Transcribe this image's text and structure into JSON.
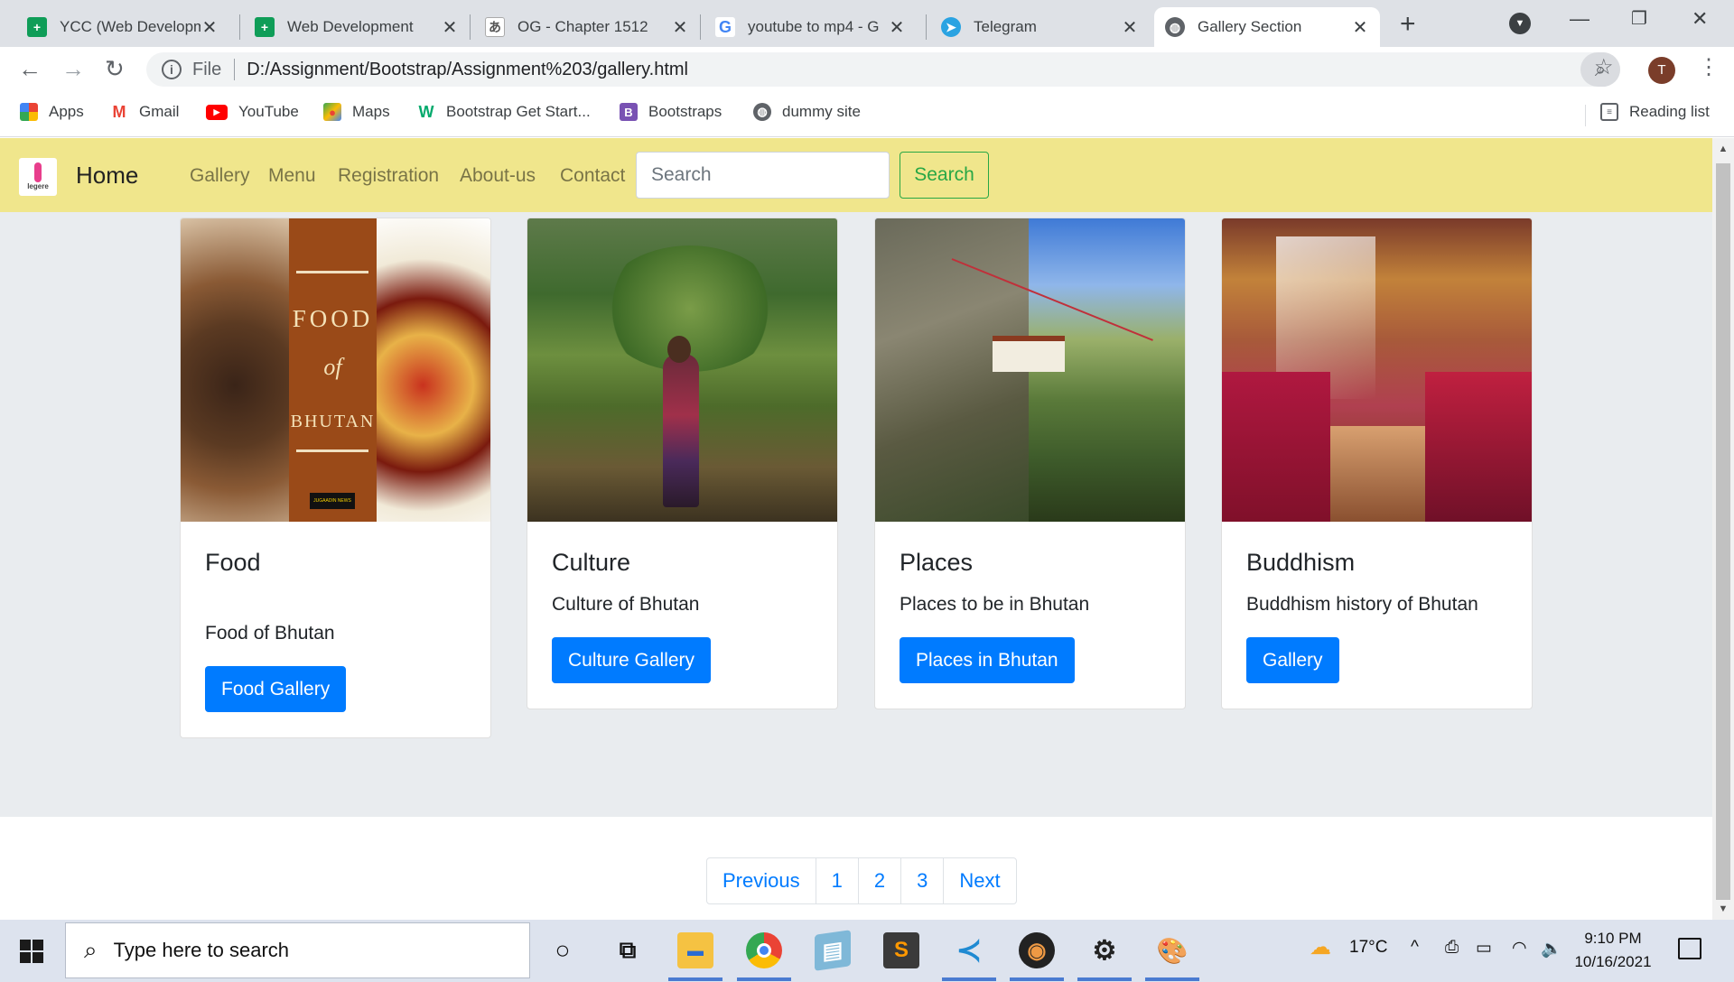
{
  "browser": {
    "tabs": [
      {
        "title": "YCC (Web Developm",
        "icon": "sheets-icon",
        "color": "#0f9d58"
      },
      {
        "title": "Web Development",
        "icon": "sheets-icon",
        "color": "#0f9d58"
      },
      {
        "title": "OG - Chapter 1512",
        "icon": "translate-icon",
        "color": "#555555"
      },
      {
        "title": "youtube to mp4 - G",
        "icon": "google-icon",
        "color": "#4285f4"
      },
      {
        "title": "Telegram",
        "icon": "telegram-icon",
        "color": "#2aa3e2"
      },
      {
        "title": "Gallery Section",
        "icon": "globe-icon",
        "color": "#5f6368",
        "active": true
      }
    ],
    "address": {
      "scheme_label": "File",
      "url": "D:/Assignment/Bootstrap/Assignment%203/gallery.html"
    },
    "profile_initial": "T",
    "bookmarks": [
      {
        "label": "Apps",
        "icon": "apps-grid-icon"
      },
      {
        "label": "Gmail",
        "icon": "gmail-icon"
      },
      {
        "label": "YouTube",
        "icon": "youtube-icon"
      },
      {
        "label": "Maps",
        "icon": "maps-icon"
      },
      {
        "label": "Bootstrap Get Start...",
        "icon": "w3schools-icon"
      },
      {
        "label": "Bootstraps",
        "icon": "bootstrap-icon"
      },
      {
        "label": "dummy site",
        "icon": "globe-icon"
      }
    ],
    "reading_list": "Reading list"
  },
  "page": {
    "navbar": {
      "logo_text": "legere",
      "brand": "Home",
      "links": [
        "Gallery",
        "Menu",
        "Registration",
        "About-us",
        "Contact"
      ],
      "search_placeholder": "Search",
      "search_button": "Search",
      "bg_color": "#f0e68c"
    },
    "cards": [
      {
        "title": "Food",
        "text": "Food of Bhutan",
        "button": "Food Gallery",
        "image_caption": [
          "FOOD",
          "of",
          "BHUTAN"
        ],
        "image_badge": "JUGAADIN NEWS"
      },
      {
        "title": "Culture",
        "text": "Culture of Bhutan",
        "button": "Culture Gallery"
      },
      {
        "title": "Places",
        "text": "Places to be in Bhutan",
        "button": "Places in Bhutan"
      },
      {
        "title": "Buddhism",
        "text": "Buddhism history of Bhutan",
        "button": "Gallery"
      }
    ],
    "pagination": [
      "Previous",
      "1",
      "2",
      "3",
      "Next"
    ],
    "accent_color": "#007bff"
  },
  "taskbar": {
    "search_placeholder": "Type here to search",
    "weather": "17°C",
    "time": "9:10 PM",
    "date": "10/16/2021"
  }
}
